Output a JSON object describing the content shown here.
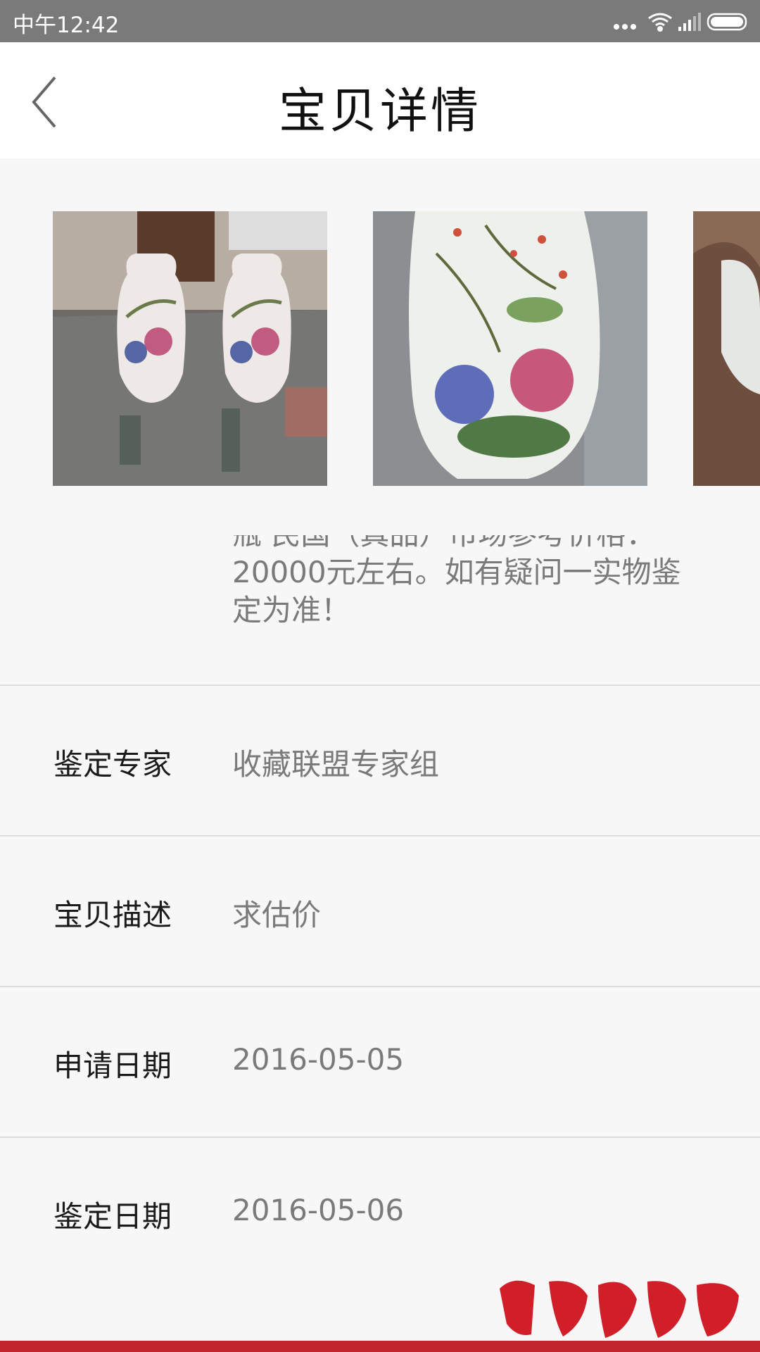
{
  "status_bar": {
    "time": "中午12:42",
    "icons": [
      "more-dots-icon",
      "wifi-icon",
      "signal-icon",
      "battery-icon"
    ]
  },
  "header": {
    "title": "宝贝详情",
    "back_icon": "chevron-left-icon"
  },
  "gallery": {
    "images": [
      {
        "name": "vase-pair-photo"
      },
      {
        "name": "vase-closeup-photo"
      },
      {
        "name": "vase-in-hand-photo"
      }
    ]
  },
  "appraisal": {
    "description_lines": [
      "瓶 民国（真品）市场参考价格：",
      "20000元左右。如有疑问一实物鉴",
      "定为准！"
    ]
  },
  "details": [
    {
      "label": "鉴定专家",
      "value": "收藏联盟专家组"
    },
    {
      "label": "宝贝描述",
      "value": "求估价"
    },
    {
      "label": "申请日期",
      "value": "2016-05-05"
    },
    {
      "label": "鉴定日期",
      "value": "2016-05-06"
    }
  ],
  "watermark": {
    "text": "微常好玩网"
  },
  "colors": {
    "status_bar": "#7a7a7a",
    "accent": "#c4262f",
    "background": "#f7f7f7"
  }
}
